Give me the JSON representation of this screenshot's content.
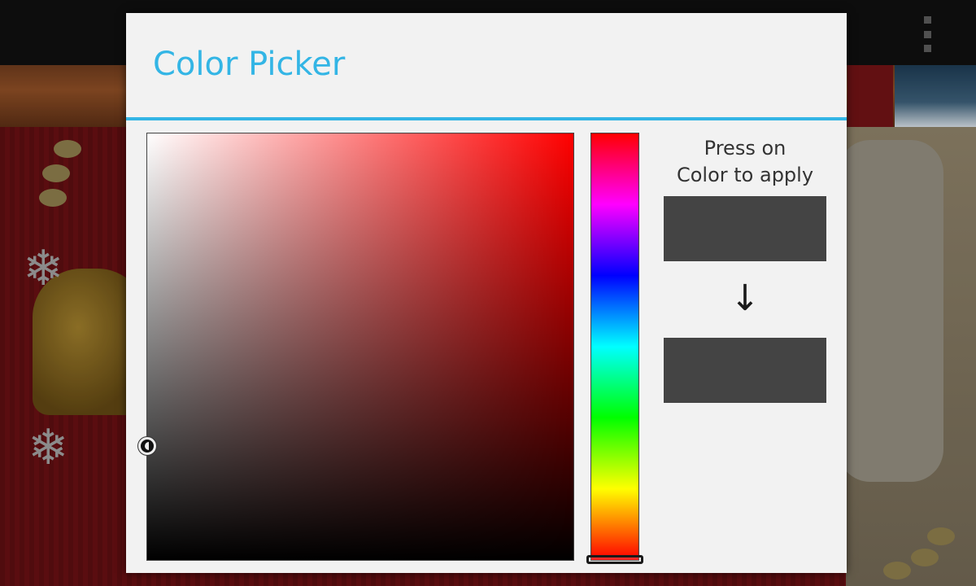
{
  "dialog": {
    "title": "Color Picker",
    "instructions_line1": "Press on",
    "instructions_line2": "Color to apply",
    "arrow_glyph": "↓"
  },
  "picker": {
    "hue_color": "#ff0000",
    "hue_position": 1.0,
    "saturation": 0.0,
    "value": 0.27,
    "old_color": "#444444",
    "new_color": "#444444"
  },
  "colors": {
    "accent": "#33b5e5",
    "dialog_background": "#f2f2f2"
  },
  "background_app": {
    "overflow_icon": "overflow-menu-icon"
  }
}
